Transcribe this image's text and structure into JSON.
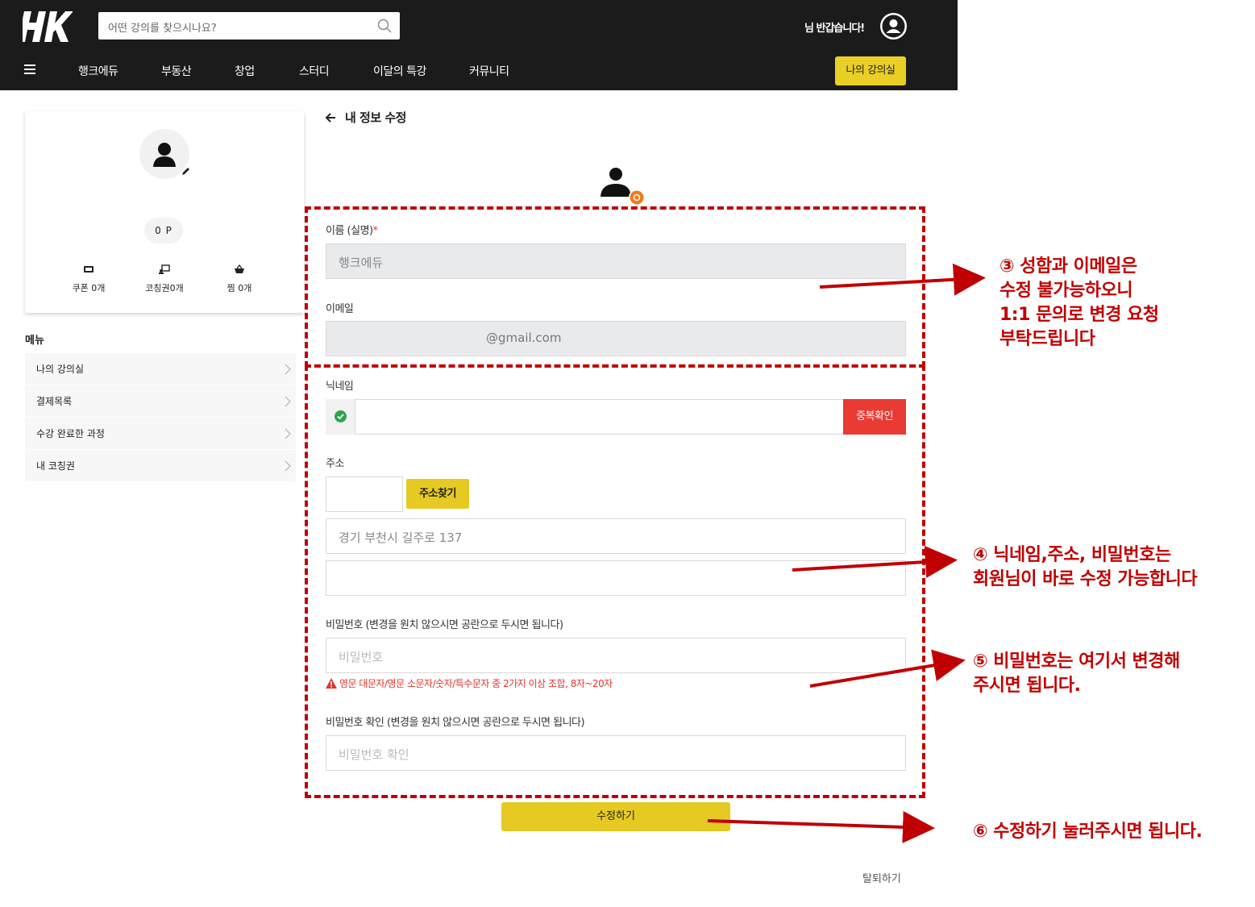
{
  "header": {
    "logo_text": "HK",
    "search_placeholder": "어떤 강의를 찾으시나요?",
    "greeting": "님 반갑습니다!",
    "nav": [
      "행크에듀",
      "부동산",
      "창업",
      "스터디",
      "이달의 특강",
      "커뮤니티"
    ],
    "my_class_button": "나의 강의실"
  },
  "profile": {
    "points": "0 P",
    "stats": [
      {
        "label": "쿠폰 0개",
        "icon": "ticket-icon"
      },
      {
        "label": "코칭권0개",
        "icon": "coaching-icon"
      },
      {
        "label": "찜 0개",
        "icon": "basket-icon"
      }
    ]
  },
  "menu": {
    "title": "메뉴",
    "items": [
      "나의 강의실",
      "결제목록",
      "수강 완료한 과정",
      "내 코칭권"
    ]
  },
  "form": {
    "page_title": "내 정보 수정",
    "name_label": "이름 (실명)",
    "required_mark": "*",
    "name_value": "행크에듀",
    "email_label": "이메일",
    "email_value": "@gmail.com",
    "nickname_label": "닉네임",
    "nickname_value": "",
    "dup_check_button": "중복확인",
    "address_label": "주소",
    "zip_value": "",
    "address_search_button": "주소찾기",
    "address_value": "경기 부천시 길주로 137",
    "address_detail_value": "",
    "password_label": "비밀번호 (변경을 원치 않으시면 공란으로 두시면 됩니다)",
    "password_placeholder": "비밀번호",
    "password_hint": "영문 대문자/영문 소문자/숫자/특수문자 중 2가지 이상 조합, 8자~20자",
    "password_confirm_label": "비밀번호 확인 (변경을 원치 않으시면 공란으로 두시면 됩니다)",
    "password_confirm_placeholder": "비밀번호 확인",
    "submit_button": "수정하기",
    "withdraw_link": "탈퇴하기"
  },
  "annotations": {
    "note3": "③ 성함과 이메일은\n수정 불가능하오니\n1:1 문의로 변경 요청\n부탁드립니다",
    "note4": "④ 닉네임,주소, 비밀번호는\n회원님이 바로 수정 가능합니다",
    "note5": "⑤ 비밀번호는 여기서 변경해\n주시면 됩니다.",
    "note6": "⑥ 수정하기 눌러주시면 됩니다."
  },
  "colors": {
    "header_bg": "#1b1b1b",
    "accent_yellow": "#e6c923",
    "danger_red": "#e93a33",
    "annotation_red": "#c00000"
  }
}
